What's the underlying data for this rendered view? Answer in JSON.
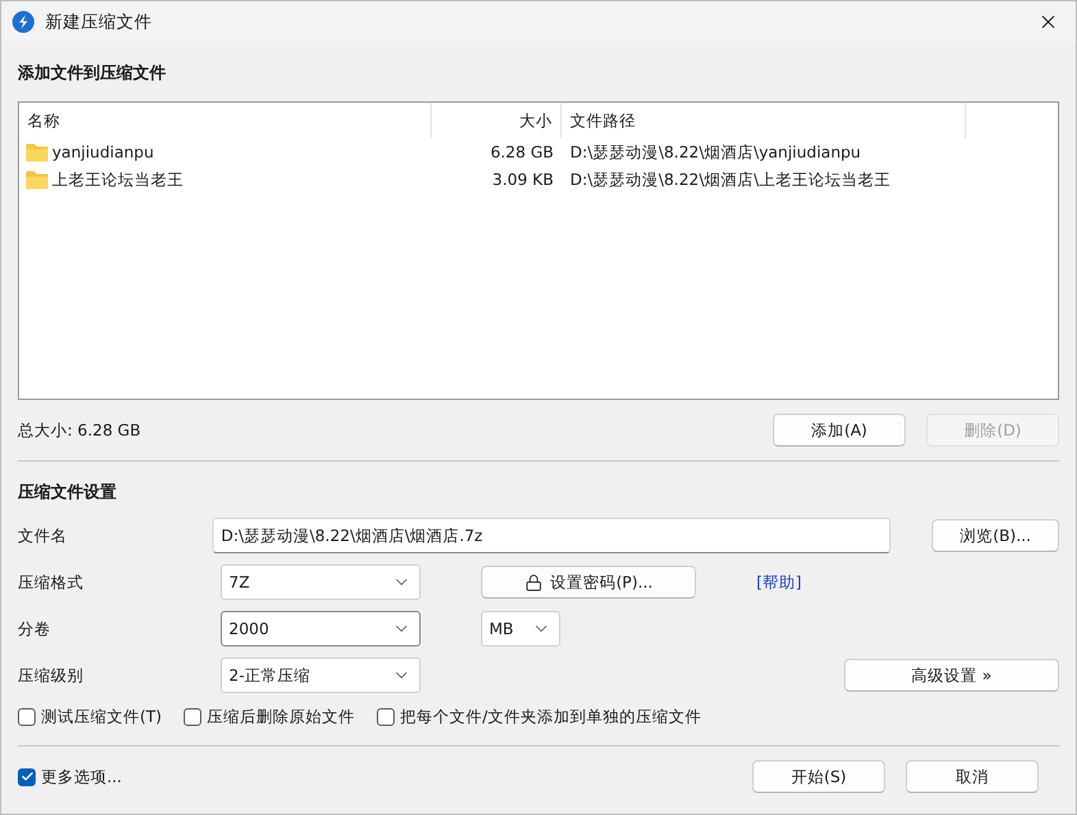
{
  "window": {
    "title": "新建压缩文件"
  },
  "files": {
    "title": "添加文件到压缩文件",
    "columns": [
      "名称",
      "大小",
      "文件路径"
    ],
    "rows": [
      {
        "name": "yanjiudianpu",
        "size": "6.28 GB",
        "path": "D:\\瑟瑟动漫\\8.22\\烟酒店\\yanjiudianpu"
      },
      {
        "name": "上老王论坛当老王",
        "size": "3.09 KB",
        "path": "D:\\瑟瑟动漫\\8.22\\烟酒店\\上老王论坛当老王"
      }
    ],
    "total": "总大小: 6.28 GB",
    "buttons": [
      {
        "label": "添加(A)",
        "disabled": false
      },
      {
        "label": "删除(D)",
        "disabled": true
      }
    ]
  },
  "settings": {
    "title": "压缩文件设置",
    "filename": {
      "label": "文件名",
      "value": "D:\\瑟瑟动漫\\8.22\\烟酒店\\烟酒店.7z"
    },
    "browse_button": {
      "label": "浏览(B)...",
      "disabled": false
    },
    "format": {
      "label": "压缩格式",
      "value": "7Z"
    },
    "password_button": {
      "label": "设置密码(P)...",
      "disabled": false
    },
    "help_link": "[帮助]",
    "volume": {
      "label": "分卷",
      "value": "2000",
      "unit": "MB"
    },
    "level": {
      "label": "压缩级别",
      "value": "2-正常压缩"
    },
    "advanced_button": {
      "label": "高级设置 »",
      "disabled": false
    },
    "options": [
      {
        "label": "测试压缩文件(T)",
        "checked": false
      },
      {
        "label": "压缩后删除原始文件",
        "checked": false
      },
      {
        "label": "把每个文件/文件夹添加到单独的压缩文件",
        "checked": false
      }
    ]
  },
  "footer": {
    "more_options": {
      "label": "更多选项...",
      "checked": true
    },
    "buttons": [
      {
        "label": "开始(S)",
        "disabled": false
      },
      {
        "label": "取消",
        "disabled": false
      }
    ]
  }
}
